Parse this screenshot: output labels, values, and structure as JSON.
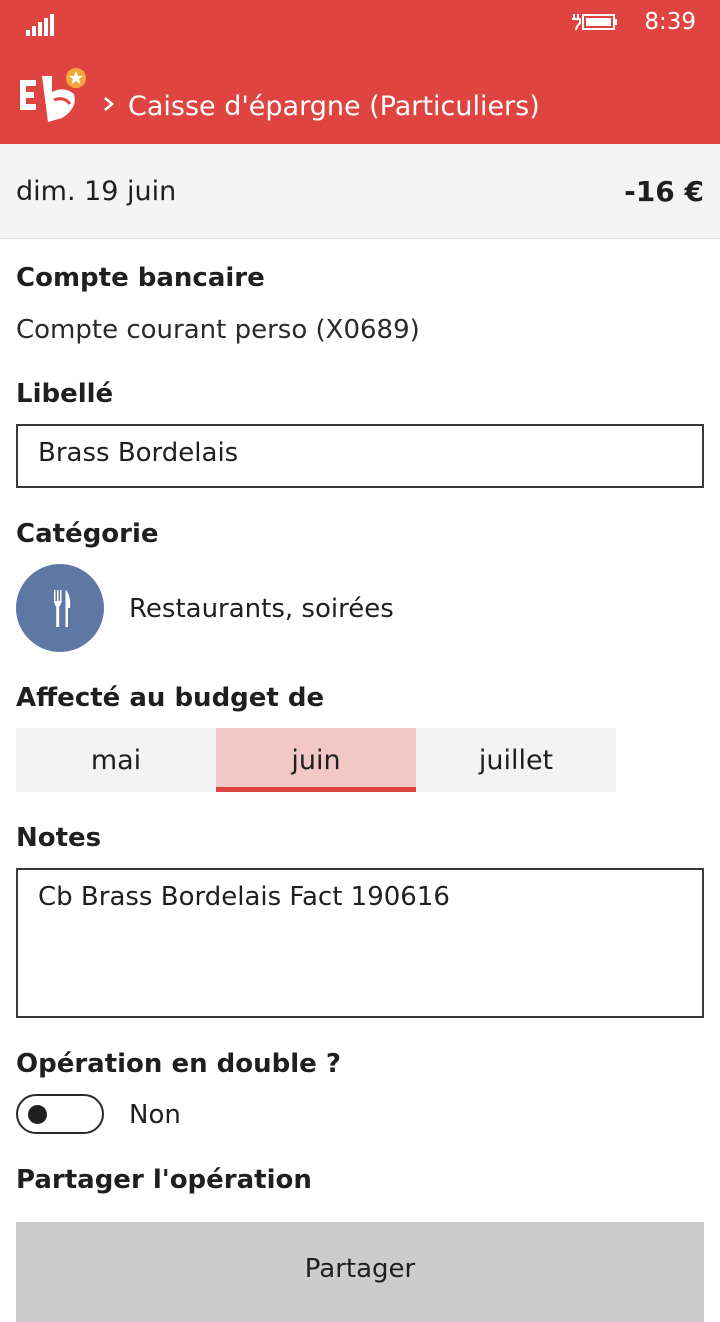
{
  "status_bar": {
    "time": "8:39",
    "signal_icon": "signal-bars-icon",
    "battery_icon": "battery-charging-icon"
  },
  "header": {
    "logo_icon": "app-logo-icon",
    "breadcrumb": "Caisse d'épargne (Particuliers)"
  },
  "transaction": {
    "date": "dim. 19 juin",
    "amount": "-16 €"
  },
  "account": {
    "label": "Compte bancaire",
    "value": "Compte courant perso (X0689)"
  },
  "libelle": {
    "label": "Libellé",
    "value": "Brass Bordelais"
  },
  "category": {
    "label": "Catégorie",
    "icon": "fork-knife-icon",
    "value": "Restaurants, soirées"
  },
  "budget": {
    "label": "Affecté au budget de",
    "options": [
      "mai",
      "juin",
      "juillet"
    ],
    "selected": "juin"
  },
  "notes": {
    "label": "Notes",
    "value": "Cb Brass Bordelais Fact 190616"
  },
  "duplicate": {
    "label": "Opération en double ?",
    "state": "Non"
  },
  "share": {
    "label": "Partager l'opération",
    "button": "Partager"
  },
  "colors": {
    "accent": "#e04440",
    "selected_segment": "#f2c8c6",
    "category_circle": "#5f77a4"
  }
}
